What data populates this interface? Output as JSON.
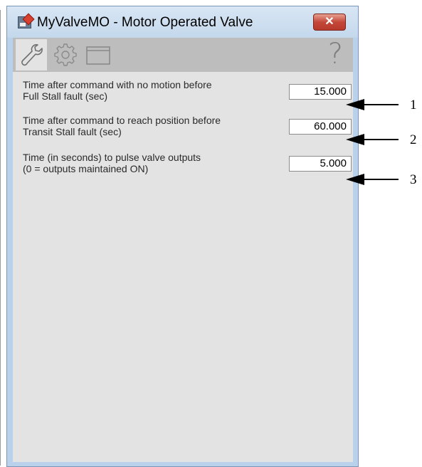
{
  "window": {
    "title": "MyValveMO - Motor Operated Valve",
    "close_glyph": "✕"
  },
  "tabs": [
    {
      "name": "wrench-icon",
      "active": true
    },
    {
      "name": "gear-icon",
      "active": false
    },
    {
      "name": "window-icon",
      "active": false
    }
  ],
  "help_glyph": "?",
  "settings": [
    {
      "label_line1": "Time after command with no motion before",
      "label_line2": "Full Stall fault (sec)",
      "value": "15.000"
    },
    {
      "label_line1": "Time after command to reach position before",
      "label_line2": "Transit Stall fault (sec)",
      "value": "60.000"
    },
    {
      "label_line1": "Time (in seconds) to pulse valve outputs",
      "label_line2": "(0 = outputs maintained ON)",
      "value": "5.000"
    }
  ],
  "callouts": [
    "1",
    "2",
    "3"
  ],
  "colors": {
    "titlebar": "#c4d8ec",
    "close": "#c4483a",
    "panel": "#e3e3e3",
    "tabbar": "#bdbdbd"
  }
}
